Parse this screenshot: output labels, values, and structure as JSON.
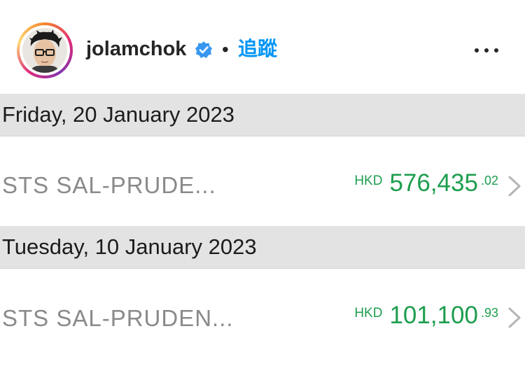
{
  "header": {
    "username": "jolamchok",
    "separator": "•",
    "follow_label": "追蹤",
    "avatar_icon": "profile-photo",
    "verified_icon": "verified-badge-icon",
    "more_icon": "more-options-icon"
  },
  "transactions": [
    {
      "date": "Friday, 20 January 2023",
      "description": "STS SAL-PRUDE...",
      "currency": "HKD",
      "amount_main": "576,435",
      "amount_cents": ".02"
    },
    {
      "date": "Tuesday, 10 January 2023",
      "description": "STS SAL-PRUDEN...",
      "currency": "HKD",
      "amount_main": "101,100",
      "amount_cents": ".93"
    }
  ],
  "colors": {
    "follow_blue": "#0095f6",
    "amount_green": "#1e9e4f",
    "date_bar_gray": "#e3e3e3",
    "label_gray": "#8a8a8a"
  }
}
